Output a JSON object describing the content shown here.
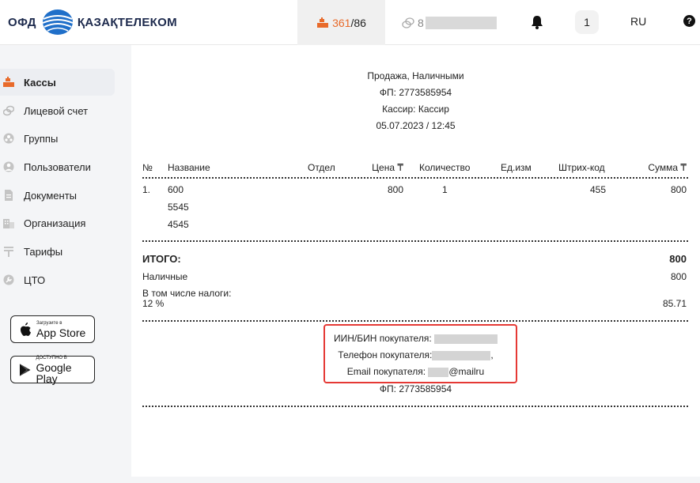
{
  "header": {
    "logo_ofd": "ОФД",
    "logo_brand": "ҚАЗАҚТЕЛЕКОМ",
    "counter_used": "361",
    "counter_sep": "/",
    "counter_total": "86",
    "balance_prefix": "8",
    "notifications_count": "1",
    "language": "RU",
    "help": "?"
  },
  "sidebar": {
    "items": [
      {
        "label": "Кассы",
        "icon": "cash-register-icon",
        "active": true
      },
      {
        "label": "Лицевой счет",
        "icon": "coins-icon"
      },
      {
        "label": "Группы",
        "icon": "groups-icon"
      },
      {
        "label": "Пользователи",
        "icon": "user-icon"
      },
      {
        "label": "Документы",
        "icon": "document-icon"
      },
      {
        "label": "Организация",
        "icon": "building-icon"
      },
      {
        "label": "Тарифы",
        "icon": "tenge-icon"
      },
      {
        "label": "ЦТО",
        "icon": "wrench-icon"
      }
    ],
    "app_store": {
      "small": "Загрузите в",
      "big": "App Store"
    },
    "google_play": {
      "small": "ДОСТУПНО В",
      "big": "Google Play"
    }
  },
  "receipt": {
    "operation": "Продажа, Наличными",
    "fp": "ФП: 2773585954",
    "cashier": "Кассир: Кассир",
    "datetime": "05.07.2023 / 12:45",
    "columns": [
      "№",
      "Название",
      "Отдел",
      "Цена ₸",
      "Количество",
      "Ед.изм",
      "Штрих-код",
      "Сумма ₸"
    ],
    "item": {
      "num": "1.",
      "names": [
        "600",
        "5545",
        "4545"
      ],
      "price": "800",
      "qty": "1",
      "barcode": "455",
      "sum": "800"
    },
    "total_label": "ИТОГО:",
    "total_value": "800",
    "payment_label": "Наличные",
    "payment_value": "800",
    "tax_label_1": "В том числе налоги:",
    "tax_label_2": "12 %",
    "tax_value": "85.71",
    "buyer_iin": "ИИН/БИН покупателя:",
    "buyer_phone": "Телефон покупателя:",
    "buyer_phone_tail": ",",
    "buyer_email": "Email покупателя:",
    "buyer_email_tail": "@mailru",
    "fp_bottom": "ФП: 2773585954"
  },
  "colors": {
    "accent": "#e86a2a",
    "highlight": "#e53935",
    "brand_blue": "#1f6fc9"
  }
}
